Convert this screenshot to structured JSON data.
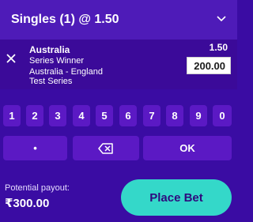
{
  "header": {
    "title": "Singles (1) @ 1.50"
  },
  "selection": {
    "team": "Australia",
    "market": "Series Winner",
    "event": "Australia - England Test Series",
    "odds": "1.50",
    "stake": "200.00"
  },
  "keypad": {
    "digits": [
      "1",
      "2",
      "3",
      "4",
      "5",
      "6",
      "7",
      "8",
      "9",
      "0"
    ],
    "dot": "•",
    "ok": "OK"
  },
  "footer": {
    "payout_label": "Potential payout:",
    "payout_value": "₹300.00",
    "place_bet": "Place Bet"
  },
  "colors": {
    "background": "#3a0ca3",
    "header": "#4e1bb8",
    "key": "#5b19c4",
    "cta": "#34d8c9",
    "cta_text": "#2e0a7d"
  },
  "icons": [
    "chevron-down-icon",
    "close-icon",
    "backspace-icon"
  ]
}
